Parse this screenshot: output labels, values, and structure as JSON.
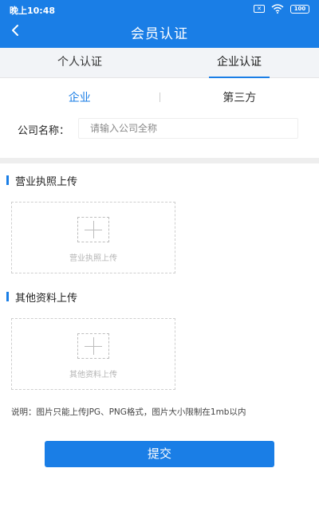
{
  "status_bar": {
    "time": "晚上10:48",
    "battery": "100"
  },
  "header": {
    "title": "会员认证"
  },
  "tabs": [
    {
      "label": "个人认证",
      "active": false
    },
    {
      "label": "企业认证",
      "active": true
    }
  ],
  "subtabs": [
    {
      "label": "企业",
      "active": true
    },
    {
      "label": "第三方",
      "active": false
    }
  ],
  "company": {
    "label": "公司名称：",
    "placeholder": "请输入公司全称",
    "value": ""
  },
  "uploads": [
    {
      "title": "营业执照上传",
      "caption": "营业执照上传"
    },
    {
      "title": "其他资料上传",
      "caption": "其他资料上传"
    }
  ],
  "note": "说明：图片只能上传JPG、PNG格式，图片大小限制在1mb以内",
  "submit_label": "提交",
  "colors": {
    "primary": "#1a7ee6",
    "tab_bg": "#f2f4f7"
  },
  "icons": {
    "back": "chevron-left-icon",
    "upload": "plus-icon"
  }
}
